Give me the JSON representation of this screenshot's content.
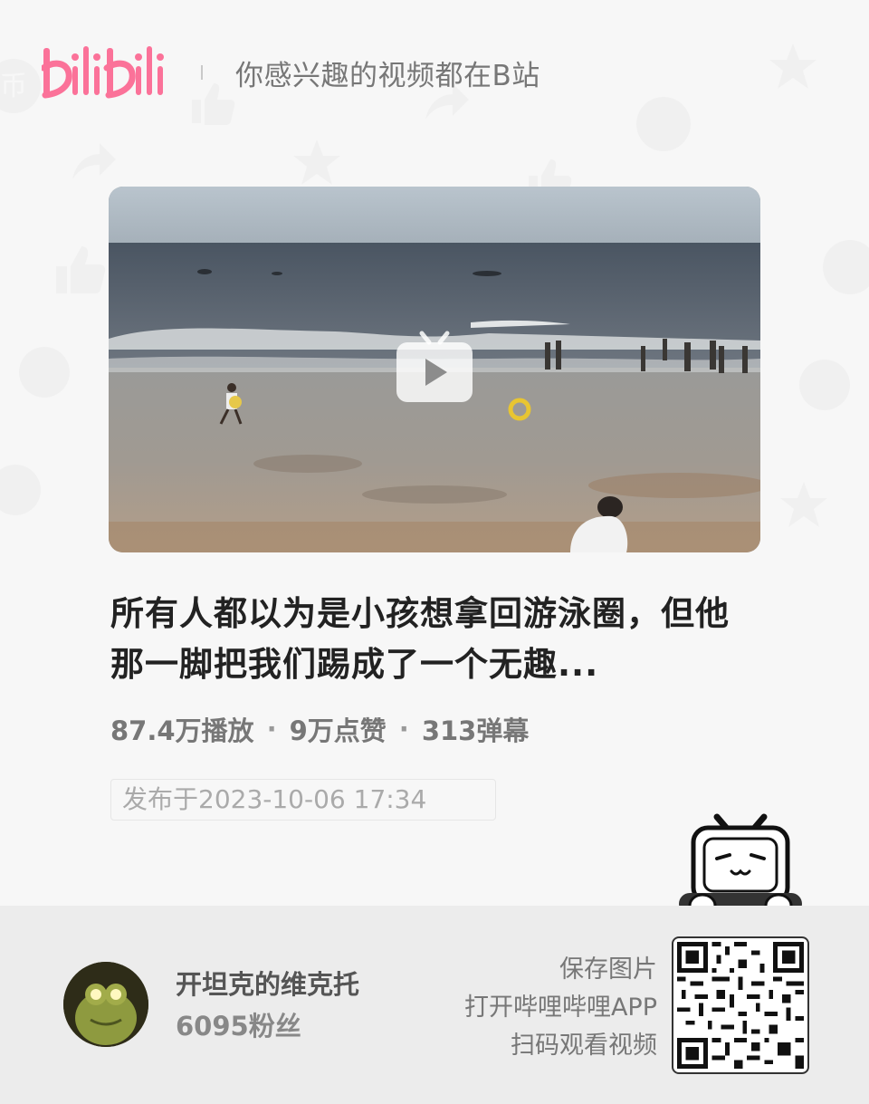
{
  "header": {
    "logo_text": "bilibili",
    "slogan": "你感兴趣的视频都在B站"
  },
  "video": {
    "title": "所有人都以为是小孩想拿回游泳圈，但他那一脚把我们踢成了一个无趣...",
    "stats": {
      "plays": "87.4万播放",
      "likes": "9万点赞",
      "danmaku": "313弹幕",
      "separator": "·"
    },
    "publish_time": "发布于2023-10-06 17:34"
  },
  "uploader": {
    "name": "开坦克的维克托",
    "fans": "6095粉丝"
  },
  "cta": {
    "line1": "保存图片",
    "line2": "打开哔哩哔哩APP",
    "line3": "扫码观看视频"
  },
  "colors": {
    "brand_pink": "#fb7299",
    "text_dark": "#222222",
    "text_muted": "#777777"
  }
}
